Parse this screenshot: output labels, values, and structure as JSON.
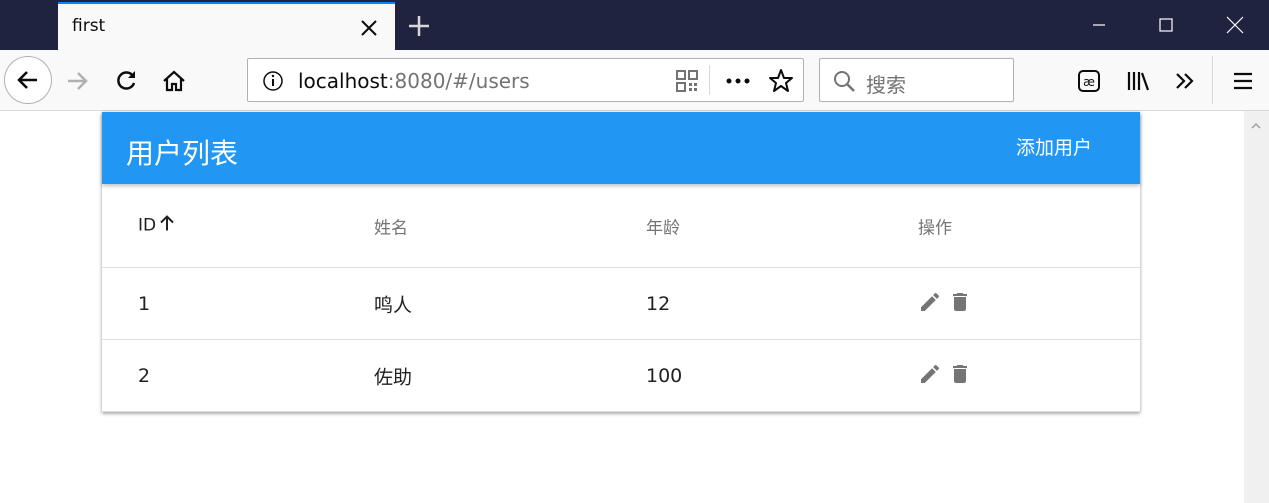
{
  "browser": {
    "tab_title": "first",
    "url_host": "localhost",
    "url_rest": ":8080/#/users",
    "search_placeholder": "搜索"
  },
  "app": {
    "title": "用户列表",
    "add_button": "添加用户",
    "accent_color": "#2196f3"
  },
  "table": {
    "headers": {
      "id": "ID",
      "name": "姓名",
      "age": "年龄",
      "actions": "操作"
    },
    "sort_icon": "arrow-up-icon",
    "rows": [
      {
        "id": "1",
        "name": "鸣人",
        "age": "12"
      },
      {
        "id": "2",
        "name": "佐助",
        "age": "100"
      }
    ],
    "row_action_icons": [
      "edit-icon",
      "delete-icon"
    ]
  }
}
